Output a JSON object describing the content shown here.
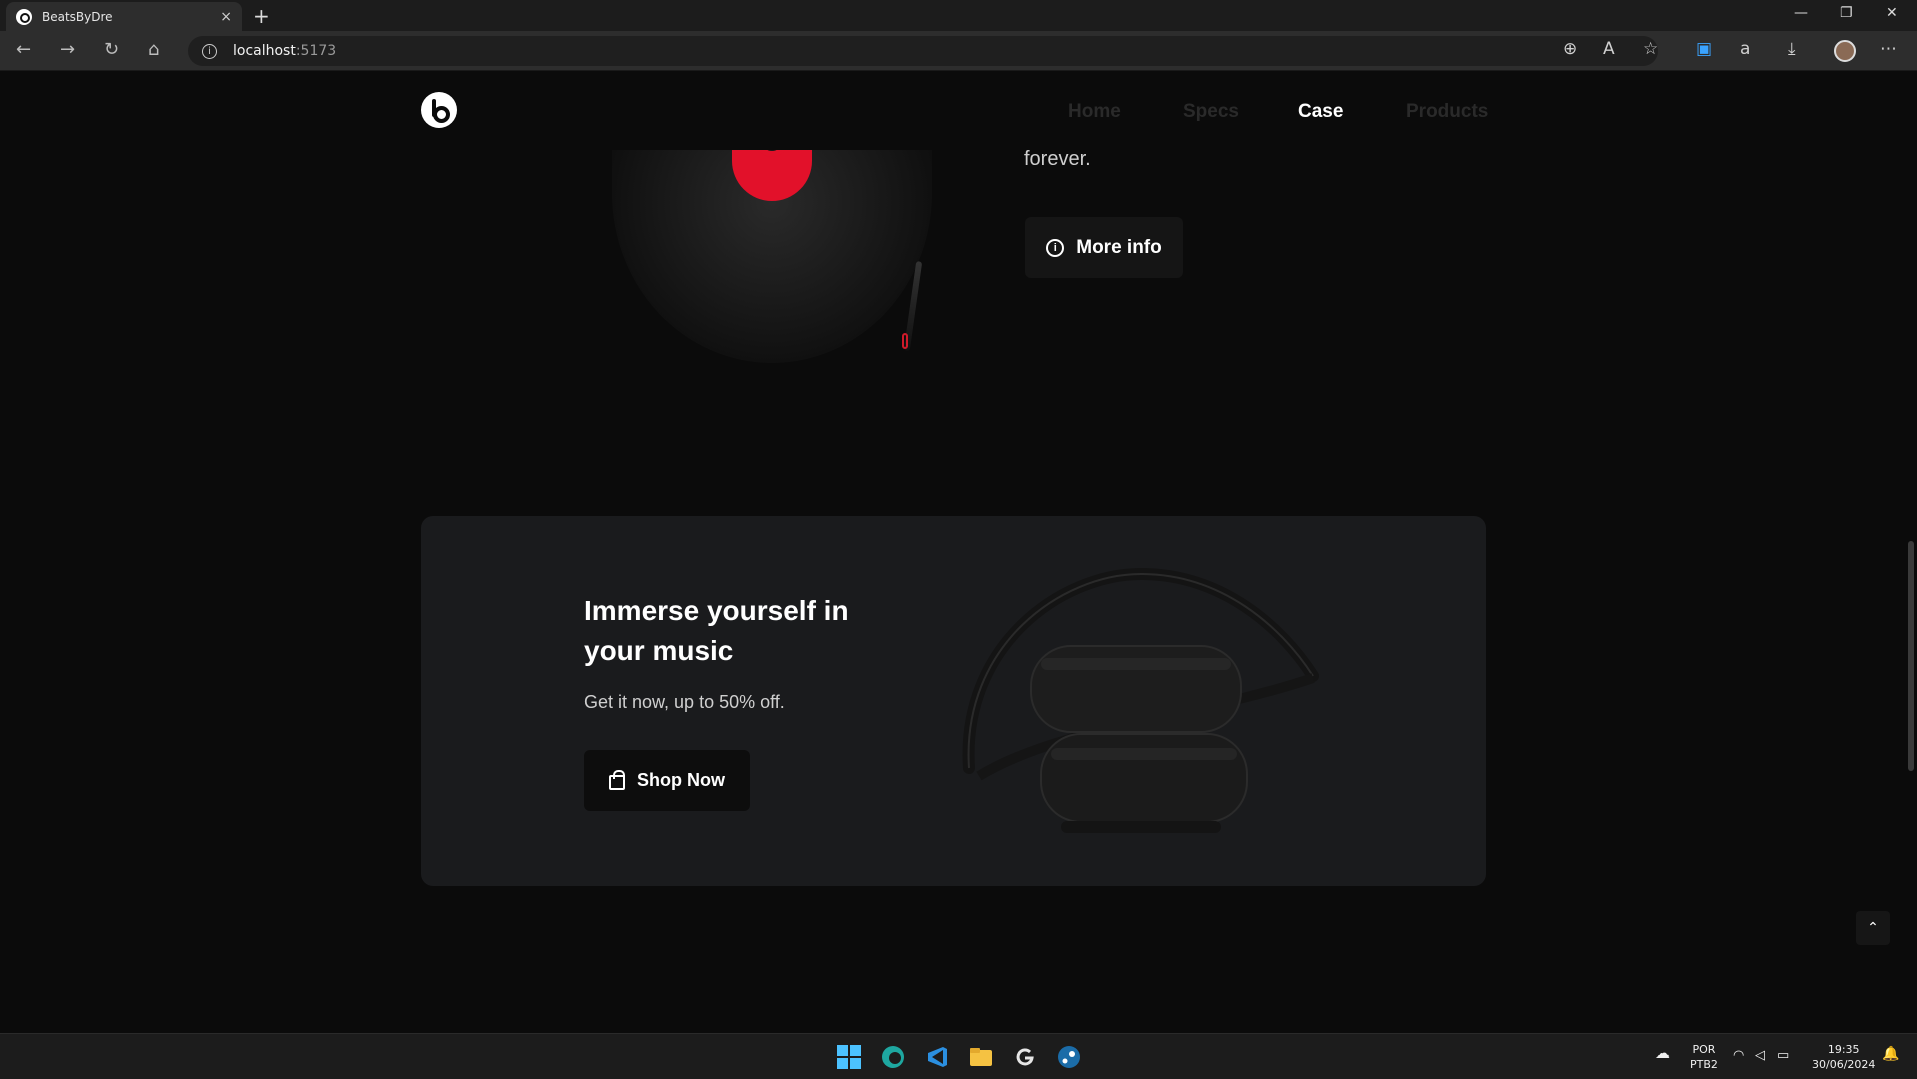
{
  "browser": {
    "tab_title": "BeatsByDre",
    "tab_close": "×",
    "new_tab": "+",
    "address_host": "localhost",
    "address_port": ":5173",
    "minimize": "—",
    "restore": "❐",
    "close": "✕"
  },
  "site": {
    "nav": [
      {
        "label": "Home",
        "active": false
      },
      {
        "label": "Specs",
        "active": false
      },
      {
        "label": "Case",
        "active": true
      },
      {
        "label": "Products",
        "active": false
      }
    ],
    "hero_text_fragment": "forever.",
    "more_info_label": "More info",
    "promo": {
      "title": "Immerse yourself in your music",
      "subtitle": "Get it now, up to 50% off.",
      "cta_label": "Shop Now"
    },
    "scroll_top_icon": "⌃"
  },
  "taskbar": {
    "language_line1": "POR",
    "language_line2": "PTB2",
    "time": "19:35",
    "date": "30/06/2024"
  },
  "colors": {
    "page_bg": "#0b0b0b",
    "card_bg": "#1a1b1d",
    "accent_red": "#e2112a",
    "muted_nav": "#2a2a2a"
  }
}
